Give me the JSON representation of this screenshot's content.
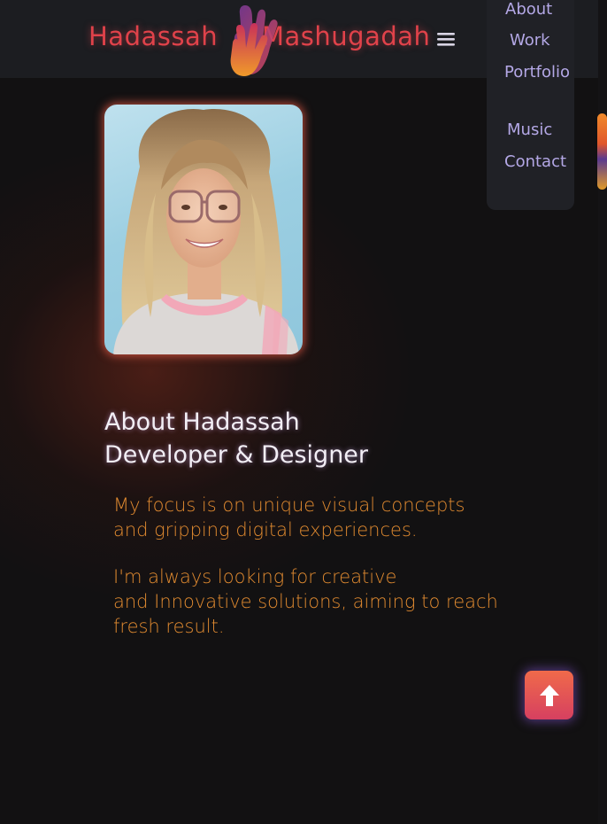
{
  "header": {
    "brand_first": "Hadassah",
    "brand_last": "Mashugadah",
    "logo_icon": "hand-logo-icon",
    "menu_icon": "hamburger-menu-icon"
  },
  "nav": {
    "items": [
      {
        "label": "About"
      },
      {
        "label": "Work"
      },
      {
        "label": "Portfolio"
      },
      {
        "label": "Music"
      },
      {
        "label": "Contact"
      }
    ]
  },
  "about": {
    "title_line1": "About Hadassah",
    "title_line2": "Developer & Designer",
    "paragraph1": [
      "My focus is on unique visual concepts",
      "and gripping digital experiences."
    ],
    "paragraph2": [
      "I'm always looking for creative",
      "and Innovative solutions, aiming to reach",
      "fresh result."
    ]
  },
  "back_to_top": {
    "icon": "arrow-up-icon"
  },
  "colors": {
    "brand": "#e0424a",
    "nav_text": "#b4a8e6",
    "body_text": "#e08a30",
    "heading": "#f2eef5",
    "background": "#121112"
  }
}
